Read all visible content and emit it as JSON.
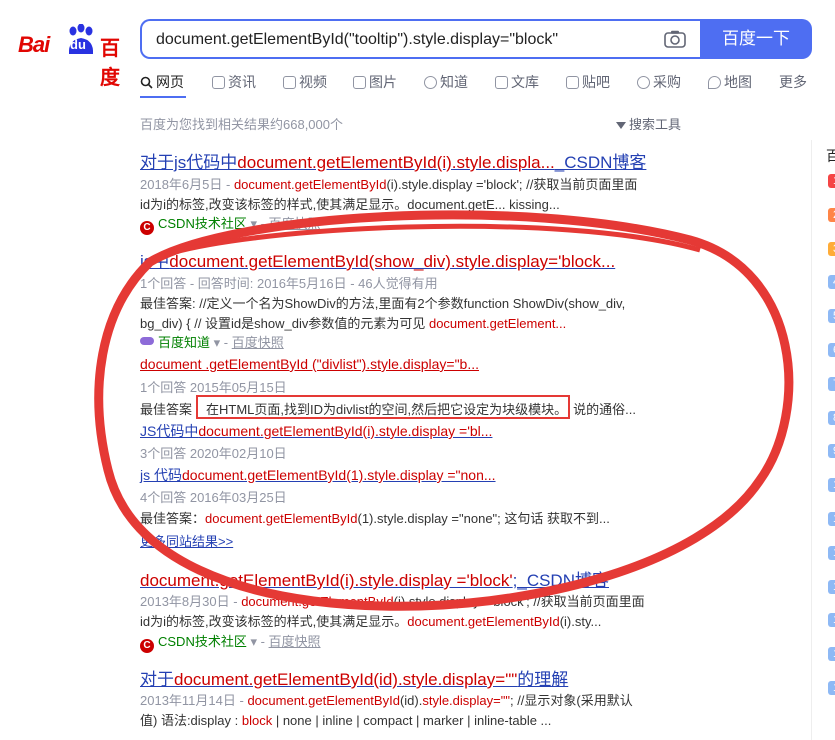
{
  "logo": {
    "part1": "Bai",
    "part2": "du",
    "part3": "百度"
  },
  "search": {
    "query": "document.getElementById(\"tooltip\").style.display=\"block\"",
    "button": "百度一下"
  },
  "tabs": [
    "网页",
    "资讯",
    "视频",
    "图片",
    "知道",
    "文库",
    "贴吧",
    "采购",
    "地图",
    "更多"
  ],
  "result_count": "百度为您找到相关结果约668,000个",
  "search_tools": "搜索工具",
  "results": [
    {
      "title_pre": "对于js代码中",
      "title_em": "document.getElementById(i).style.displa...",
      "title_post": "_CSDN博客",
      "date": "2018年6月5日",
      "snip_a": "document.getElementById",
      "snip_b": "(i).style.display ='block'; //获取当前页面里面",
      "snip2": "id为i的标签,改变该标签的样式,使其满足显示。document.getE... kissing...",
      "source": "CSDN技术社区",
      "snapshot": "百度快照"
    },
    {
      "title_pre": "js中",
      "title_em": "document.getElementById(show_div).style.display='block...",
      "meta": "1个回答 - 回答时间: 2016年5月16日 - 46人觉得有用",
      "answer1": "最佳答案: //定义一个名为ShowDiv的方法,里面有2个参数function ShowDiv(show_div,",
      "answer2a": "bg_div) { // 设置id是show_div参数值的元素为可见 ",
      "answer2b": "document.getElement...",
      "source": "百度知道",
      "snapshot": "百度快照",
      "subs": [
        {
          "title": "document .getElementById (\"divlist\").style.display=\"b...",
          "meta": "1个回答   2015年05月15日",
          "ans_label": "最佳答案",
          "ans_box": "在HTML页面,找到ID为divlist的空间,然后把它设定为块级模块。",
          "ans_tail": "说的通俗..."
        },
        {
          "title_pre": "JS代码中",
          "title_em": "document.getElementById(i).style.display ='bl...",
          "meta": "3个回答   2020年02月10日"
        },
        {
          "title_pre": "js 代码",
          "title_em": "document.getElementById(1).style.display =\"non...",
          "meta": "4个回答   2016年03月25日",
          "ans_label": "最佳答案：",
          "ans_em": "document.getElementById",
          "ans_tail": "(1).style.display =\"none\"; 这句话 获取不到..."
        }
      ],
      "more": "更多同站结果>>"
    },
    {
      "title_em": "document.getElementById(i).style.display ='block'",
      "title_post": ";_CSDN博客",
      "date": "2013年8月30日",
      "snip_a": "document.getElementById",
      "snip_b": "(i).style.display ='block'; //获取当前页面里面",
      "snip2a": "id为i的标签,改变该标签的样式,使其满足显示。",
      "snip2b": "document.getElementById",
      "snip2c": "(i).sty...",
      "source": "CSDN技术社区",
      "snapshot": "百度快照"
    },
    {
      "title_pre": "对于",
      "title_em": "document.getElementById(id).style.display=\"\"",
      "title_post": "的理解",
      "date": "2013年11月14日",
      "snip_a": "document.getElementById",
      "snip_b": "(id).",
      "snip_c": "style.display=\"\"",
      "snip_d": "; //显示对象(采用默认",
      "snip2a": "值) 语法:display : ",
      "snip2b": "block",
      "snip2c": " | none | inline | compact | marker | inline-table ..."
    }
  ],
  "hot": {
    "heading": "百",
    "ranks": [
      "1",
      "2",
      "3",
      "4",
      "5",
      "6",
      "7",
      "8",
      "9",
      "1",
      "1",
      "1",
      "1",
      "1",
      "1",
      "1"
    ]
  },
  "colors": {
    "accent": "#4e6ef2",
    "link": "#2440b3",
    "em": "#cc0000",
    "annotation": "#e53935"
  }
}
